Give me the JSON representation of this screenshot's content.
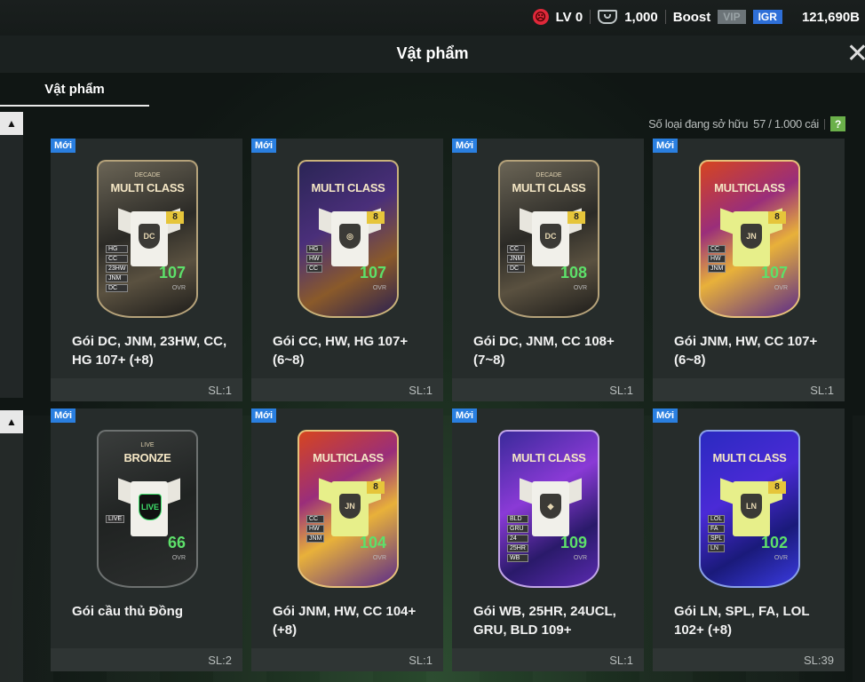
{
  "status": {
    "level": "LV 0",
    "coins": "1,000",
    "boost": "Boost",
    "vip": "VIP",
    "igr": "IGR",
    "bp": "121,690B"
  },
  "header": {
    "title": "Vật phẩm"
  },
  "tabs": [
    {
      "label": "Vật phẩm"
    }
  ],
  "count": {
    "label": "Số loại đang sở hữu",
    "value": "57 / 1.000 cái",
    "help": "?"
  },
  "items": [
    {
      "badge": "Mới",
      "name": "Gói DC, JNM, 23HW, CC, HG 107+ (+8)",
      "qty": "SL:1",
      "pack_top": "DECADE",
      "pack_title": "MULTI CLASS",
      "crest": "DC",
      "tags": [
        "HG",
        "CC",
        "23HW",
        "JNM",
        "DC"
      ],
      "ovr": "107",
      "ovr_label": "OVR",
      "num": "8",
      "style": "dc"
    },
    {
      "badge": "Mới",
      "name": "Gói CC, HW, HG 107+ (6~8)",
      "qty": "SL:1",
      "pack_top": "",
      "pack_title": "MULTI CLASS",
      "crest": "◎",
      "tags": [
        "HG",
        "HW",
        "CC"
      ],
      "ovr": "107",
      "ovr_label": "OVR",
      "num": "8",
      "style": "mc"
    },
    {
      "badge": "Mới",
      "name": "Gói DC, JNM, CC 108+ (7~8)",
      "qty": "SL:1",
      "pack_top": "DECADE",
      "pack_title": "MULTI CLASS",
      "crest": "DC",
      "tags": [
        "CC",
        "JNM",
        "DC"
      ],
      "ovr": "108",
      "ovr_label": "OVR",
      "num": "8",
      "style": "dc"
    },
    {
      "badge": "Mới",
      "name": "Gói JNM, HW, CC 107+ (6~8)",
      "qty": "SL:1",
      "pack_top": "",
      "pack_title": "MULTICLASS",
      "crest": "JN",
      "tags": [
        "CC",
        "HW",
        "JNM"
      ],
      "ovr": "107",
      "ovr_label": "OVR",
      "num": "8",
      "style": "lt",
      "yellow": true
    },
    {
      "badge": "Mới",
      "name": "Gói cầu thủ Đồng",
      "qty": "SL:2",
      "pack_top": "LIVE",
      "pack_title": "BRONZE",
      "crest": "LIVE",
      "tags": [
        "LIVE"
      ],
      "ovr": "66",
      "ovr_label": "OVR",
      "num": "",
      "style": "br"
    },
    {
      "badge": "Mới",
      "name": "Gói JNM, HW, CC 104+ (+8)",
      "qty": "SL:1",
      "pack_top": "",
      "pack_title": "MULTICLASS",
      "crest": "JN",
      "tags": [
        "CC",
        "HW",
        "JNM"
      ],
      "ovr": "104",
      "ovr_label": "OVR",
      "num": "8",
      "style": "lt",
      "yellow": true
    },
    {
      "badge": "Mới",
      "name": "Gói WB, 25HR, 24UCL, GRU, BLD 109+",
      "qty": "SL:1",
      "pack_top": "",
      "pack_title": "MULTI CLASS",
      "crest": "◆",
      "tags": [
        "BLD",
        "GRU",
        "24",
        "25HR",
        "WB"
      ],
      "ovr": "109",
      "ovr_label": "OVR",
      "num": "",
      "style": "pu"
    },
    {
      "badge": "Mới",
      "name": "Gói LN, SPL, FA, LOL 102+ (+8)",
      "qty": "SL:39",
      "pack_top": "",
      "pack_title": "MULTI CLASS",
      "crest": "LN",
      "tags": [
        "LOL",
        "FA",
        "SPL",
        "LN"
      ],
      "ovr": "102",
      "ovr_label": "OVR",
      "num": "8",
      "style": "bl",
      "yellow": true
    }
  ]
}
